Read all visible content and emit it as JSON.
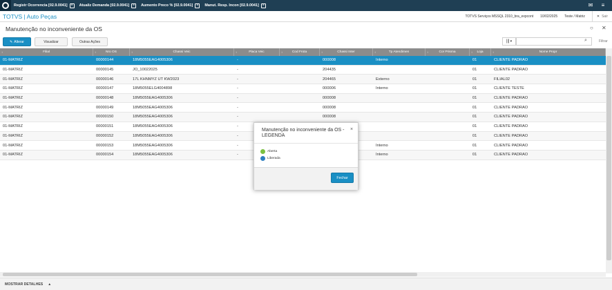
{
  "taskbar": {
    "tabs": [
      {
        "label": "Registr Ocorrencia [02.9.0041]"
      },
      {
        "label": "Atualiz Demanda [02.9.0041]"
      },
      {
        "label": "Aumento Preco % [02.9.0041]"
      },
      {
        "label": "Manut. Resp. Incon [02.9.0041]"
      }
    ],
    "close_glyph": "×",
    "mail_icon": "✉",
    "menu_icon": "≡"
  },
  "appbar": {
    "title": "TOTVS | Auto Peças",
    "env": "TOTVS Serviços MSSQL 2310_bra_expcont",
    "date": "10/02/2025",
    "company": "Teste / Matriz",
    "exit": "Sair",
    "exit_glyph": "✕"
  },
  "page": {
    "title": "Manutenção no inconveniente da OS",
    "help_glyph": "○",
    "close_glyph": "✕"
  },
  "toolbar": {
    "alterar": "Alterar",
    "visualizar": "Visualizar",
    "outras_acoes": "Outras Ações",
    "view_glyph": "|||",
    "view_caret": "▾",
    "filtrar": "Filtrar",
    "search_placeholder": ""
  },
  "columns": [
    "Filial",
    "Nro OS",
    "Chassi Veic",
    "Placa Veic",
    "Cod Frota",
    "Chassi Inter",
    "Tp Atendimen",
    "Cor Prisma",
    "Loja",
    "Nome Propr"
  ],
  "rows": [
    [
      "01-MATRIZ",
      "00000144",
      "18M5055EAG4005306",
      "-",
      "",
      "000008",
      "Interno",
      "",
      "01",
      "CLIENTE PADRAO"
    ],
    [
      "01-MATRIZ",
      "00000145",
      "JO_10022025",
      "-",
      "",
      "204435",
      "",
      "",
      "01",
      "CLIENTE PADRAO"
    ],
    [
      "01-MATRIZ",
      "00000146",
      "17L KHNMYZ UT KW2023",
      "-",
      "",
      "204465",
      "Externo",
      "",
      "01",
      "FILIAL02"
    ],
    [
      "01-MATRIZ",
      "00000147",
      "18M5055ELG4004898",
      "-",
      "",
      "000006",
      "Interno",
      "",
      "01",
      "CLIENTE TESTE"
    ],
    [
      "01-MATRIZ",
      "00000148",
      "18M5055EAG4005306",
      "-",
      "",
      "000008",
      "",
      "",
      "01",
      "CLIENTE PADRAO"
    ],
    [
      "01-MATRIZ",
      "00000149",
      "18M5055EAG4005306",
      "-",
      "",
      "000008",
      "",
      "",
      "01",
      "CLIENTE PADRAO"
    ],
    [
      "01-MATRIZ",
      "00000150",
      "18M5055EAG4005306",
      "-",
      "",
      "000008",
      "",
      "",
      "01",
      "CLIENTE PADRAO"
    ],
    [
      "01-MATRIZ",
      "00000151",
      "18M5055EAG4005306",
      "-",
      "",
      "",
      "",
      "",
      "01",
      "CLIENTE PADRAO"
    ],
    [
      "01-MATRIZ",
      "00000152",
      "18M5055EAG4005306",
      "-",
      "",
      "",
      "",
      "",
      "01",
      "CLIENTE PADRAO"
    ],
    [
      "01-MATRIZ",
      "00000153",
      "18M5055EAG4005306",
      "-",
      "",
      "",
      "Interno",
      "",
      "01",
      "CLIENTE PADRAO"
    ],
    [
      "01-MATRIZ",
      "00000154",
      "18M5055EAG4005306",
      "-",
      "",
      "",
      "Interno",
      "",
      "01",
      "CLIENTE PADRAO"
    ]
  ],
  "selected_row": 0,
  "footer": {
    "details": "MOSTRAR DETALHES",
    "chevron": "▲"
  },
  "dialog": {
    "title": "Manutenção no inconveniente da OS - LEGENDA",
    "close_glyph": "×",
    "legend": [
      {
        "label": "Aberta",
        "color": "#7cc142"
      },
      {
        "label": "Liberada",
        "color": "#2f7fc1"
      }
    ],
    "button": "Fechar"
  },
  "colors": {
    "accent": "#1a8fc4",
    "taskbar": "#1f3f54",
    "header": "#8c8c8c"
  }
}
